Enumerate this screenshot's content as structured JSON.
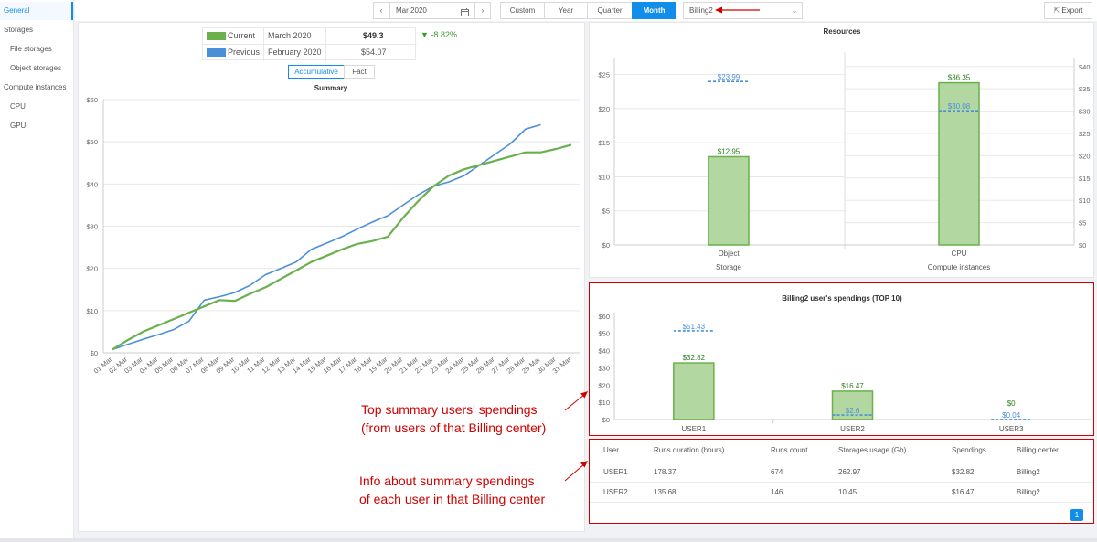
{
  "sidebar": {
    "items": [
      {
        "label": "General",
        "active": true
      },
      {
        "label": "Storages"
      },
      {
        "label": "File storages"
      },
      {
        "label": "Object storages"
      },
      {
        "label": "Compute instances"
      },
      {
        "label": "CPU"
      },
      {
        "label": "GPU"
      }
    ]
  },
  "toolbar": {
    "prev_symbol": "‹",
    "next_symbol": "›",
    "date_value": "Mar 2020",
    "period_tabs": [
      "Custom",
      "Year",
      "Quarter",
      "Month"
    ],
    "active_period": "Month",
    "billing_center": "Billing2",
    "export_label": "Export"
  },
  "summary_panel": {
    "legend": {
      "current": {
        "label": "Current",
        "period": "March 2020",
        "value": "$49.3",
        "change": "-8.82%"
      },
      "previous": {
        "label": "Previous",
        "period": "February 2020",
        "value": "$54.07"
      }
    },
    "mode_tabs": [
      "Accumulative",
      "Fact"
    ],
    "active_mode": "Accumulative"
  },
  "users_table": {
    "columns": [
      "User",
      "Runs duration (hours)",
      "Runs count",
      "Storages usage (Gb)",
      "Spendings",
      "Billing center"
    ],
    "rows": [
      [
        "USER1",
        "178.37",
        "674",
        "262.97",
        "$32.82",
        "Billing2"
      ],
      [
        "USER2",
        "135.68",
        "146",
        "10.45",
        "$16.47",
        "Billing2"
      ]
    ],
    "page": "1"
  },
  "annotations": {
    "top_users": [
      "Top summary users' spendings",
      "(from users of that Billing center)"
    ],
    "info_users": [
      "Info about summary spendings",
      "of each user in that Billing center"
    ]
  },
  "colors": {
    "accent": "#108ee9",
    "current": "#6ab04c",
    "previous": "#4a90d9",
    "bar_fill": "#b3d7a0",
    "annotation_red": "#d00000",
    "negative_change": "#3a9a2a"
  },
  "icons": {
    "calendar": "calendar-icon",
    "export": "export-icon",
    "dropdown": "chevron-down-icon",
    "change": "triangle-down-icon"
  },
  "chart_data": [
    {
      "type": "line",
      "title": "Summary",
      "ylim": [
        0,
        60
      ],
      "yticks": [
        "$0",
        "$10",
        "$20",
        "$30",
        "$40",
        "$50",
        "$60"
      ],
      "categories": [
        "01 Mar",
        "02 Mar",
        "03 Mar",
        "04 Mar",
        "05 Mar",
        "06 Mar",
        "07 Mar",
        "08 Mar",
        "09 Mar",
        "10 Mar",
        "11 Mar",
        "12 Mar",
        "13 Mar",
        "14 Mar",
        "15 Mar",
        "16 Mar",
        "17 Mar",
        "18 Mar",
        "19 Mar",
        "20 Mar",
        "21 Mar",
        "22 Mar",
        "23 Mar",
        "24 Mar",
        "25 Mar",
        "26 Mar",
        "27 Mar",
        "28 Mar",
        "29 Mar",
        "30 Mar",
        "31 Mar"
      ],
      "series": [
        {
          "name": "Current",
          "values": [
            0.8,
            3,
            5,
            6.5,
            8,
            9.5,
            11,
            12.5,
            12.3,
            14,
            15.5,
            17.5,
            19.5,
            21.5,
            23,
            24.5,
            25.8,
            26.5,
            27.5,
            32,
            36,
            39.5,
            42,
            43.5,
            44.5,
            45.5,
            46.5,
            47.5,
            47.5,
            48.3,
            49.3
          ]
        },
        {
          "name": "Previous",
          "values": [
            0.8,
            2,
            3.2,
            4.3,
            5.5,
            7.5,
            12.5,
            13.3,
            14.3,
            16,
            18.5,
            20,
            21.5,
            24.5,
            26,
            27.5,
            29.3,
            31,
            32.5,
            35,
            37.5,
            39.5,
            40.5,
            42,
            44.5,
            47,
            49.5,
            53,
            54.07
          ]
        }
      ]
    },
    {
      "type": "bar",
      "title": "Resources",
      "groups": [
        {
          "label": "Storage",
          "categories": [
            "Object"
          ],
          "current": [
            12.95
          ],
          "previous": [
            23.99
          ],
          "current_labels": [
            "$12.95"
          ],
          "previous_labels": [
            "$23.99"
          ],
          "yticks": [
            "$0",
            "$5",
            "$10",
            "$15",
            "$20",
            "$25"
          ],
          "ylim": [
            0,
            27.5
          ]
        },
        {
          "label": "Compute instances",
          "categories": [
            "CPU"
          ],
          "current": [
            36.35
          ],
          "previous": [
            30.08
          ],
          "current_labels": [
            "$36.35"
          ],
          "previous_labels": [
            "$30.08"
          ],
          "yticks": [
            "$0",
            "$5",
            "$10",
            "$15",
            "$20",
            "$25",
            "$30",
            "$35",
            "$40"
          ],
          "ylim": [
            0,
            42
          ]
        }
      ]
    },
    {
      "type": "bar",
      "title": "Billing2 user's spendings (TOP 10)",
      "categories": [
        "USER1",
        "USER2",
        "USER3"
      ],
      "current": [
        32.82,
        16.47,
        0
      ],
      "previous": [
        51.43,
        2.6,
        0.04
      ],
      "current_labels": [
        "$32.82",
        "$16.47",
        "$0"
      ],
      "previous_labels": [
        "$51.43",
        "$2.6",
        "$0.04"
      ],
      "yticks": [
        "$0",
        "$10",
        "$20",
        "$30",
        "$40",
        "$50",
        "$60"
      ],
      "ylim": [
        0,
        62
      ]
    }
  ]
}
